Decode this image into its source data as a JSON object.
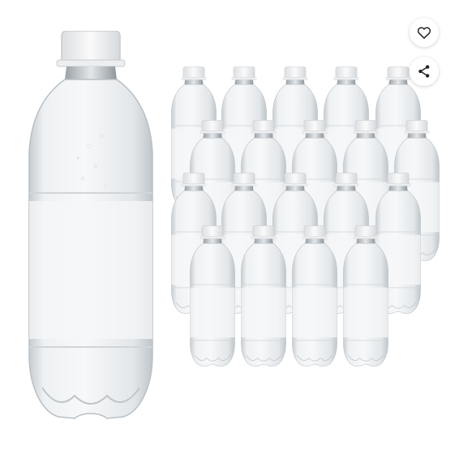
{
  "product_image": {
    "alt": "",
    "bottle_count_in_pack": 20
  },
  "actions": {
    "favorite_icon": "heart-outline-icon",
    "share_icon": "share-icon"
  },
  "colors": {
    "cap": "#f4f4f4",
    "water": "#e6eaec",
    "plastic_edge": "#c9cfd3",
    "background": "#ffffff"
  }
}
